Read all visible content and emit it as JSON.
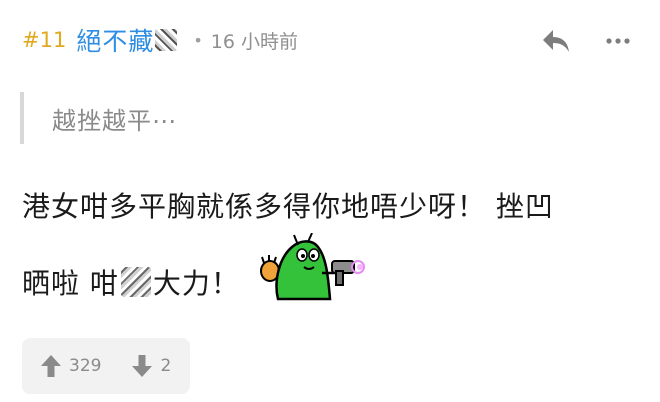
{
  "post": {
    "floor": "#11",
    "username": "絕不藏",
    "separator": "•",
    "timestamp": "16 小時前",
    "quote": "越挫越平⋯",
    "body_line1": "港女咁多平胸就係多得你地唔少呀！ 挫凹",
    "body_line2_before": "晒啦 咁",
    "body_line2_after": "大力！",
    "upvotes": "329",
    "downvotes": "2"
  },
  "icons": {
    "reply": "reply-icon",
    "more": "more-options-icon",
    "upvote": "arrow-up-icon",
    "downvote": "arrow-down-icon",
    "sticker": "green-blob-sticker-icon"
  },
  "colors": {
    "floor": "#e2a81f",
    "username": "#2f8ee3",
    "muted": "#8f8f8f",
    "vote_bg": "#f2f2f2"
  }
}
